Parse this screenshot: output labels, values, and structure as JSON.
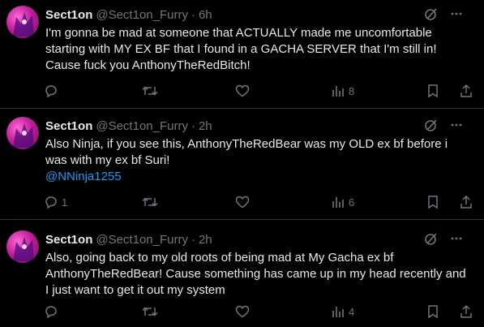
{
  "tweets": [
    {
      "name": "Sect1on",
      "handle": "@Sect1on_Furry",
      "time": "6h",
      "text": "I'm gonna be mad at someone that ACTUALLY made me uncomfortable starting with MY EX BF that I found in a GACHA SERVER that I'm still in! Cause fuck you AnthonyTheRedBitch!",
      "mention": "",
      "reply_count": "",
      "views_count": "8"
    },
    {
      "name": "Sect1on",
      "handle": "@Sect1on_Furry",
      "time": "2h",
      "text": "Also Ninja, if you see this, AnthonyTheRedBear was my OLD ex bf before i was with my ex bf Suri!",
      "mention": "@NNinja1255",
      "reply_count": "1",
      "views_count": "6"
    },
    {
      "name": "Sect1on",
      "handle": "@Sect1on_Furry",
      "time": "2h",
      "text": "Also, going back to my old roots of being mad at My Gacha ex bf AnthonyTheRedBear! Cause something has came up in my head recently and I just want to get it out my system",
      "mention": "",
      "reply_count": "",
      "views_count": "4"
    }
  ],
  "colors": {
    "background": "#000000",
    "text": "#e7e9ea",
    "secondary": "#71767b",
    "link": "#1d9bf0",
    "divider": "#2f3336"
  },
  "icons": [
    "avatar",
    "grok-icon",
    "more-icon",
    "reply-icon",
    "retweet-icon",
    "like-icon",
    "views-icon",
    "bookmark-icon",
    "share-icon"
  ]
}
